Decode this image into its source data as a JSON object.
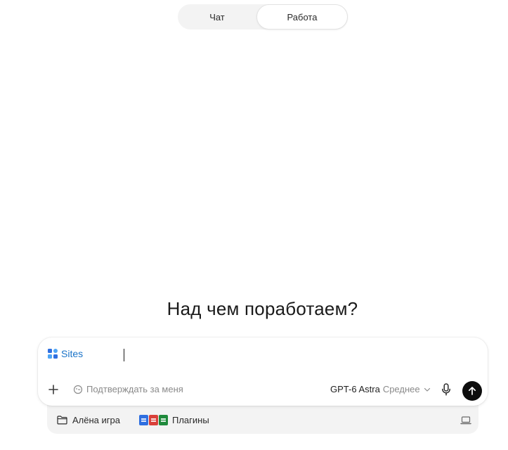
{
  "mode_toggle": {
    "chat_label": "Чат",
    "work_label": "Работа",
    "active": "Работа"
  },
  "heading": "Над чем поработаем?",
  "composer": {
    "tag_label": "Sites",
    "input_value": "",
    "auto_confirm_label": "Подтверждать за меня",
    "model_name": "GPT-6 Astra",
    "model_level": "Среднее"
  },
  "tray": {
    "project_label": "Алёна игра",
    "plugins_label": "Плагины",
    "plugin_icons": [
      "docs-icon",
      "pdf-icon",
      "sheets-icon"
    ]
  },
  "colors": {
    "accent": "#1a73c8",
    "send_button": "#0d0d0d",
    "plugin_docs": "#2f6fe0",
    "plugin_pdf": "#d9413a",
    "plugin_sheets": "#1f8a3c"
  },
  "icons": {
    "plus": "plus-icon",
    "auto_confirm": "robot-face-icon",
    "model_dropdown": "chevron-down-icon",
    "mic": "microphone-icon",
    "send": "arrow-up-icon",
    "project": "folder-icon",
    "device": "laptop-icon"
  }
}
